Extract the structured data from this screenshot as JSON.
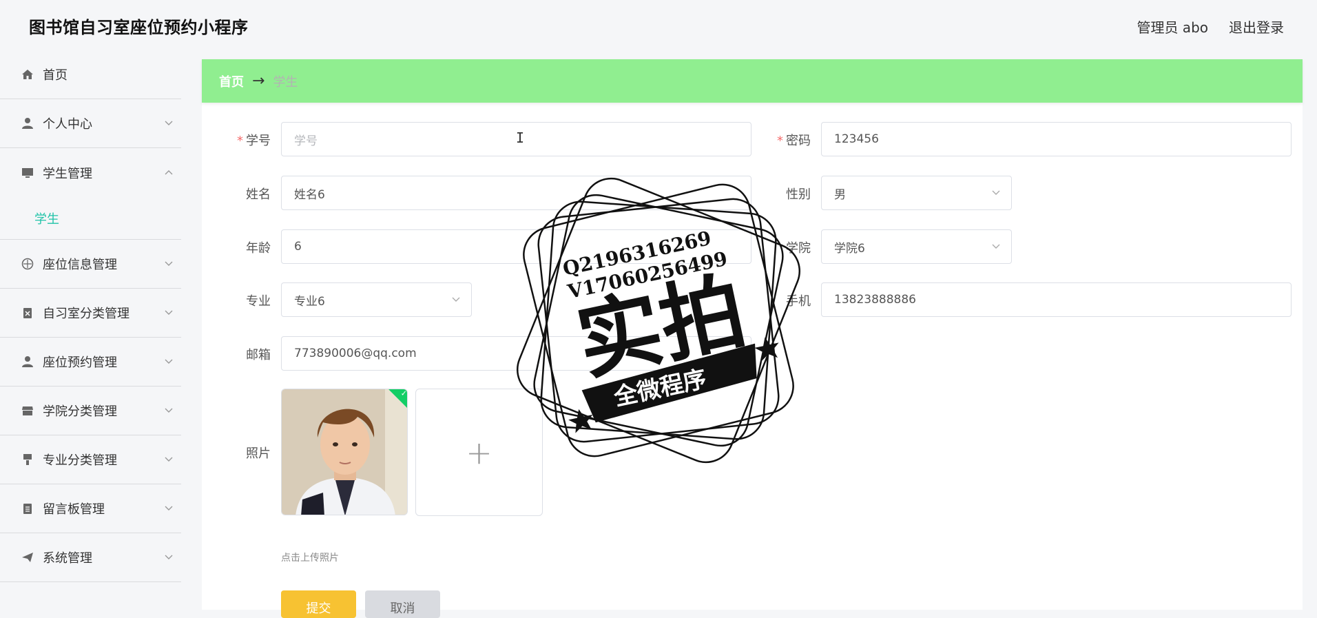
{
  "header": {
    "app_title": "图书馆自习室座位预约小程序",
    "admin_label": "管理员 abo",
    "logout_label": "退出登录"
  },
  "sidebar": {
    "items": [
      {
        "label": "首页",
        "icon": "home-icon"
      },
      {
        "label": "个人中心",
        "icon": "user-icon"
      },
      {
        "label": "学生管理",
        "icon": "monitor-icon",
        "expanded": true,
        "sub": [
          "学生"
        ]
      },
      {
        "label": "座位信息管理",
        "icon": "compass-icon"
      },
      {
        "label": "自习室分类管理",
        "icon": "clipboard-icon"
      },
      {
        "label": "座位预约管理",
        "icon": "person-icon"
      },
      {
        "label": "学院分类管理",
        "icon": "store-icon"
      },
      {
        "label": "专业分类管理",
        "icon": "brush-icon"
      },
      {
        "label": "留言板管理",
        "icon": "notebook-icon"
      },
      {
        "label": "系统管理",
        "icon": "send-icon"
      }
    ]
  },
  "breadcrumb": {
    "home": "首页",
    "arrow": "→",
    "current": "学生"
  },
  "form": {
    "student_no": {
      "label": "学号",
      "placeholder": "学号",
      "value": ""
    },
    "password": {
      "label": "密码",
      "value": "123456"
    },
    "name": {
      "label": "姓名",
      "value": "姓名6"
    },
    "gender": {
      "label": "性别",
      "value": "男"
    },
    "age": {
      "label": "年龄",
      "value": "6"
    },
    "college": {
      "label": "学院",
      "value": "学院6"
    },
    "major": {
      "label": "专业",
      "value": "专业6"
    },
    "phone": {
      "label": "手机",
      "value": "13823888886"
    },
    "email": {
      "label": "邮箱",
      "value": "773890006@qq.com"
    },
    "photo": {
      "label": "照片",
      "upload_tip": "点击上传照片",
      "plus": "+"
    },
    "submit_label": "提交",
    "cancel_label": "取消"
  },
  "watermark": {
    "line1": "Q2196316269",
    "line2": "V17060256499",
    "big": "实拍",
    "banner": "全微程序"
  },
  "colors": {
    "breadcrumb_bg": "#90ee90",
    "active_sub": "#21c3a8",
    "submit": "#f7c232",
    "required": "#f56c6c"
  }
}
